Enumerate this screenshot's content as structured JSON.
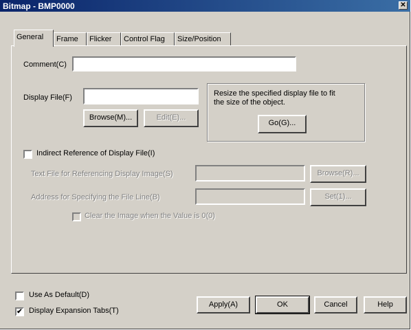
{
  "window": {
    "title": "Bitmap - BMP0000",
    "close_glyph": "✕"
  },
  "tabs": [
    {
      "label": "General",
      "active": true
    },
    {
      "label": "Frame"
    },
    {
      "label": "Flicker"
    },
    {
      "label": "Control Flag"
    },
    {
      "label": "Size/Position"
    }
  ],
  "general": {
    "comment_label": "Comment(C)",
    "comment_value": "",
    "display_file_label": "Display File(F)",
    "display_file_value": "",
    "browse_label": "Browse(M)...",
    "edit_label": "Edit(E)...",
    "resize_text_line1": "Resize the specified display file to fit",
    "resize_text_line2": "the size of the object.",
    "go_label": "Go(G)...",
    "indirect_label": "Indirect Reference of Display File(I)",
    "indirect_checked": false,
    "text_file_label": "Text File for Referencing Display Image(S)",
    "text_file_value": "",
    "browse2_label": "Browse(R)...",
    "address_label": "Address for Specifying the File Line(B)",
    "address_value": "",
    "set_label": "Set(1)...",
    "clear_label": "Clear the Image when the Value is 0(0)",
    "clear_checked": false
  },
  "footer": {
    "use_default_label": "Use As Default(D)",
    "use_default_checked": false,
    "expansion_label": "Display Expansion Tabs(T)",
    "expansion_checked": true,
    "checkmark": "✔",
    "apply_label": "Apply(A)",
    "ok_label": "OK",
    "cancel_label": "Cancel",
    "help_label": "Help"
  }
}
